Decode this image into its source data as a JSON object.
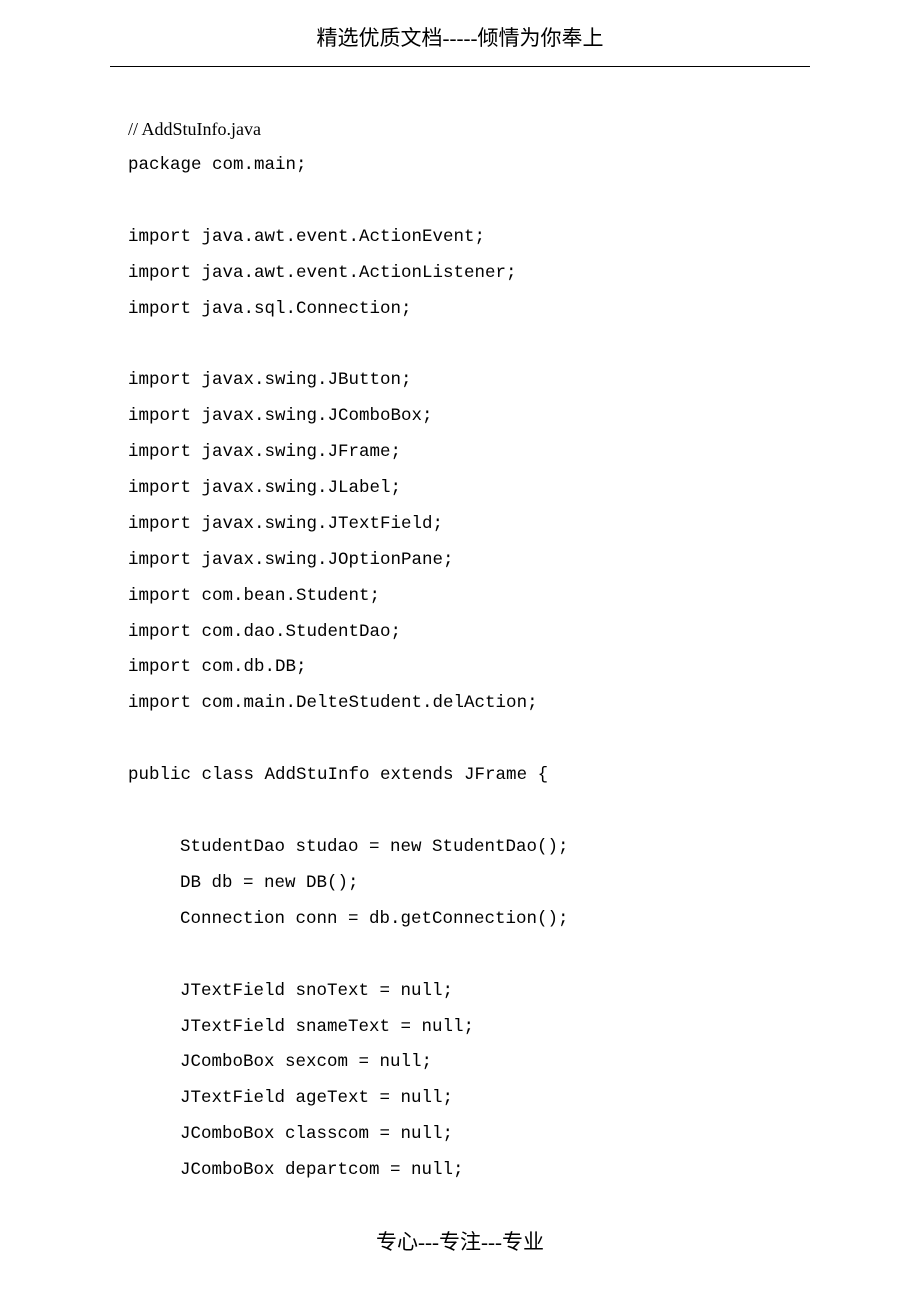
{
  "header": {
    "text": "精选优质文档-----倾情为你奉上"
  },
  "code": {
    "comment": "// AddStuInfo.java",
    "lines": [
      "package com.main;",
      "",
      "import java.awt.event.ActionEvent;",
      "import java.awt.event.ActionListener;",
      "import java.sql.Connection;",
      "",
      "import javax.swing.JButton;",
      "import javax.swing.JComboBox;",
      "import javax.swing.JFrame;",
      "import javax.swing.JLabel;",
      "import javax.swing.JTextField;",
      "import javax.swing.JOptionPane;",
      "import com.bean.Student;",
      "import com.dao.StudentDao;",
      "import com.db.DB;",
      "import com.main.DelteStudent.delAction;",
      "",
      "public class AddStuInfo extends JFrame {",
      ""
    ],
    "indented": [
      "StudentDao studao = new StudentDao();",
      "DB db = new DB();",
      "Connection conn = db.getConnection();",
      "",
      "JTextField snoText = null;",
      "JTextField snameText = null;",
      "JComboBox sexcom = null;",
      "JTextField ageText = null;",
      "JComboBox classcom = null;",
      "JComboBox departcom = null;"
    ]
  },
  "footer": {
    "text": "专心---专注---专业"
  }
}
